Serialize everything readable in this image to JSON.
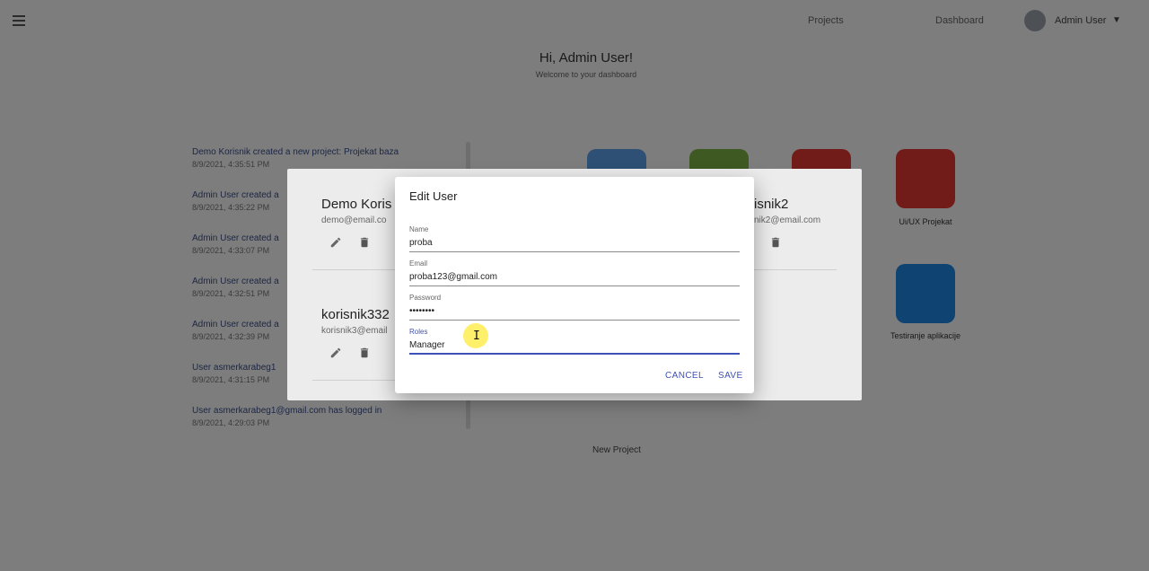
{
  "header": {
    "item1": "Projects",
    "item2": "Dashboard",
    "user_name": "Admin User"
  },
  "page": {
    "greeting": "Hi, Admin User!",
    "subtitle": "Welcome to your dashboard"
  },
  "activity": [
    {
      "title": "Demo Korisnik created a new project: Projekat baza",
      "date": "8/9/2021, 4:35:51 PM"
    },
    {
      "title": "Admin User created a",
      "date": "8/9/2021, 4:35:22 PM"
    },
    {
      "title": "Admin User created a",
      "date": "8/9/2021, 4:33:07 PM"
    },
    {
      "title": "Admin User created a",
      "date": "8/9/2021, 4:32:51 PM"
    },
    {
      "title": "Admin User created a",
      "date": "8/9/2021, 4:32:39 PM"
    },
    {
      "title": "User asmerkarabeg1",
      "date": "8/9/2021, 4:31:15 PM"
    },
    {
      "title": "User asmerkarabeg1@gmail.com has logged in",
      "date": "8/9/2021, 4:29:03 PM"
    }
  ],
  "projects": [
    {
      "label": "",
      "color": "#5aa0e8"
    },
    {
      "label": "",
      "color": "#7cb342"
    },
    {
      "label": "",
      "color": "#e53935"
    },
    {
      "label": "Ui/UX Projekat",
      "color": "#e53935"
    },
    {
      "label": "Testiranje aplikacije",
      "color": "#1e88e5"
    }
  ],
  "new_project": "New Project",
  "users": [
    {
      "name": "Demo Koris",
      "email": "demo@email.co"
    },
    {
      "name": "korisnik332",
      "email": "korisnik3@email"
    },
    {
      "name": "isnik2",
      "email": "nik2@email.com"
    }
  ],
  "dialog": {
    "title": "Edit User",
    "fields": {
      "name": {
        "label": "Name",
        "value": "proba"
      },
      "email": {
        "label": "Email",
        "value": "proba123@gmail.com"
      },
      "password": {
        "label": "Password",
        "value": "••••••••"
      },
      "roles": {
        "label": "Roles",
        "value": "Manager"
      }
    },
    "cancel": "CANCEL",
    "save": "SAVE"
  },
  "colors": {
    "accent": "#3f51b5"
  },
  "icons": {
    "edit": "pencil-icon",
    "delete": "trash-icon",
    "menu": "hamburger-icon",
    "expand": "chevron-down-icon"
  }
}
